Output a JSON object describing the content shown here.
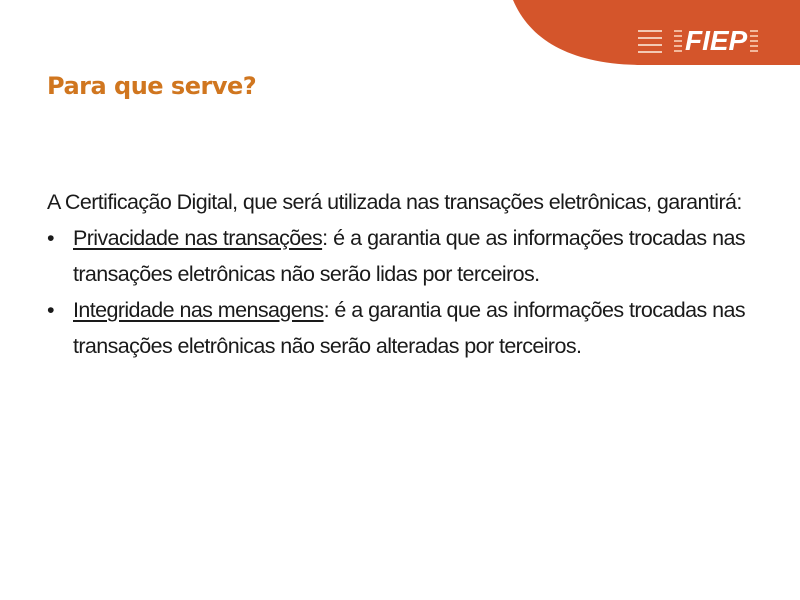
{
  "header": {
    "logo_text": "FIEP",
    "logo_icon": "fiep-seal-icon",
    "brand_color": "#d4552b"
  },
  "slide": {
    "title": "Para que serve?",
    "title_color": "#d0761f",
    "intro": "A Certificação Digital, que será utilizada nas transações eletrônicas, garantirá:",
    "bullets": [
      {
        "term_words": [
          "Privacidade",
          "nas",
          "transações"
        ],
        "term": "Privacidade nas transações",
        "text": ": é a garantia que as informações trocadas nas transações eletrônicas não serão lidas por terceiros."
      },
      {
        "term_words": [
          "Integridade",
          "nas",
          "mensagens"
        ],
        "term": "Integridade nas mensagens",
        "text": ": é a garantia que as informações trocadas nas transações eletrônicas não serão alteradas por terceiros."
      }
    ],
    "bullet_glyph": "•"
  }
}
